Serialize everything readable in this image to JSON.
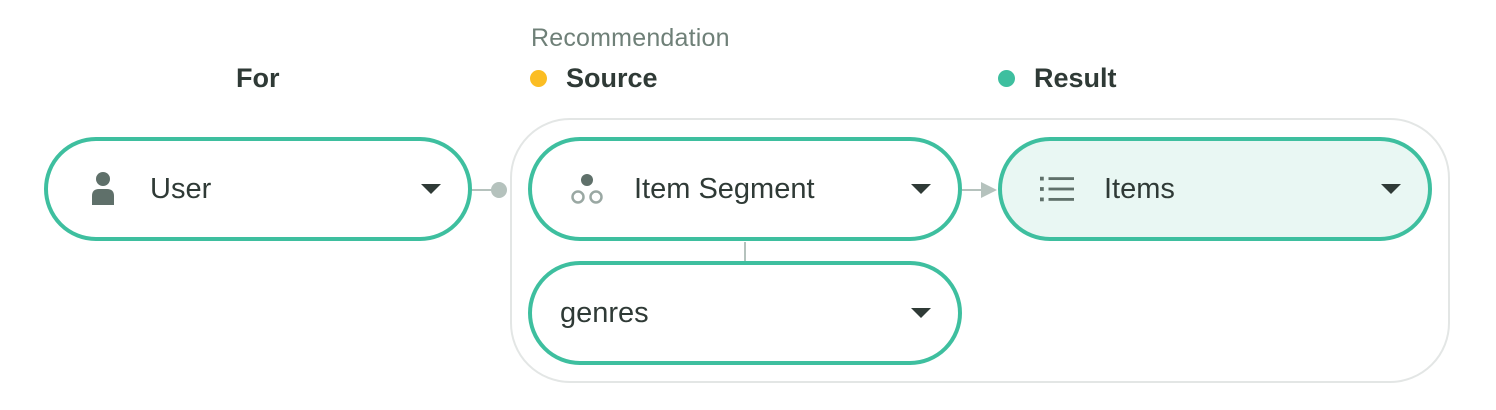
{
  "section_caption": "Recommendation",
  "headings": {
    "for": "For",
    "source": "Source",
    "result": "Result"
  },
  "colors": {
    "source_dot": "#fbbd23",
    "result_dot": "#3ebf9f",
    "pill_border": "#3ebf9f",
    "result_pill_fill": "#e9f7f3",
    "connector": "#b5c2bd",
    "icon": "#5f706a"
  },
  "nodes": {
    "user": {
      "label": "User",
      "icon": "person-icon"
    },
    "item_segment": {
      "label": "Item Segment",
      "icon": "segment-icon"
    },
    "genres": {
      "label": "genres"
    },
    "items": {
      "label": "Items",
      "icon": "list-icon"
    }
  }
}
